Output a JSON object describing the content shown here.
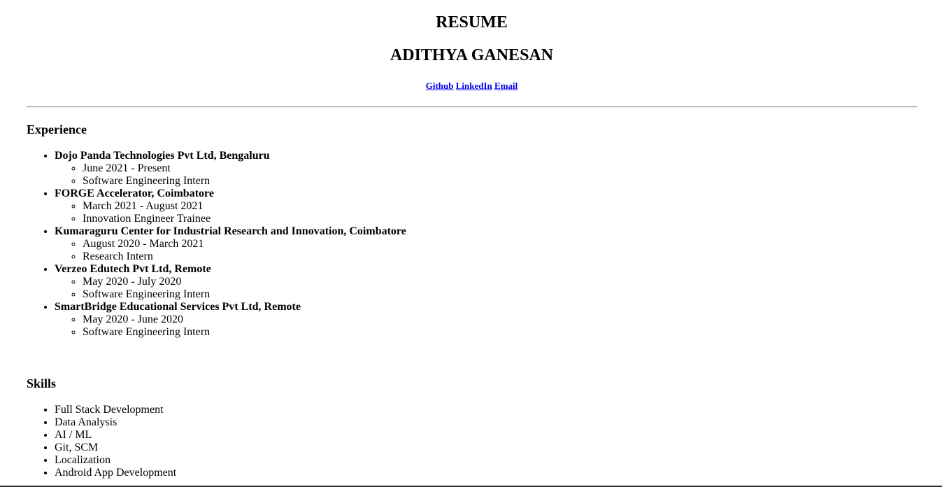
{
  "header": {
    "title": "RESUME",
    "name": "ADITHYA GANESAN",
    "links": {
      "github": "Github",
      "linkedin": "LinkedIn",
      "email": "Email"
    }
  },
  "experience": {
    "heading": "Experience",
    "items": [
      {
        "company": "Dojo Panda Technologies Pvt Ltd, Bengaluru",
        "period": "June 2021 - Present",
        "role": "Software Engineering Intern"
      },
      {
        "company": "FORGE Accelerator, Coimbatore",
        "period": "March 2021 - August 2021",
        "role": "Innovation Engineer Trainee"
      },
      {
        "company": "Kumaraguru Center for Industrial Research and Innovation, Coimbatore",
        "period": "August 2020 - March 2021",
        "role": "Research Intern"
      },
      {
        "company": "Verzeo Edutech Pvt Ltd, Remote",
        "period": "May 2020 - July 2020",
        "role": "Software Engineering Intern"
      },
      {
        "company": "SmartBridge Educational Services Pvt Ltd, Remote",
        "period": "May 2020 - June 2020",
        "role": "Software Engineering Intern"
      }
    ]
  },
  "skills": {
    "heading": "Skills",
    "items": [
      "Full Stack Development",
      "Data Analysis",
      "AI / ML",
      "Git, SCM",
      "Localization",
      "Android App Development"
    ]
  }
}
